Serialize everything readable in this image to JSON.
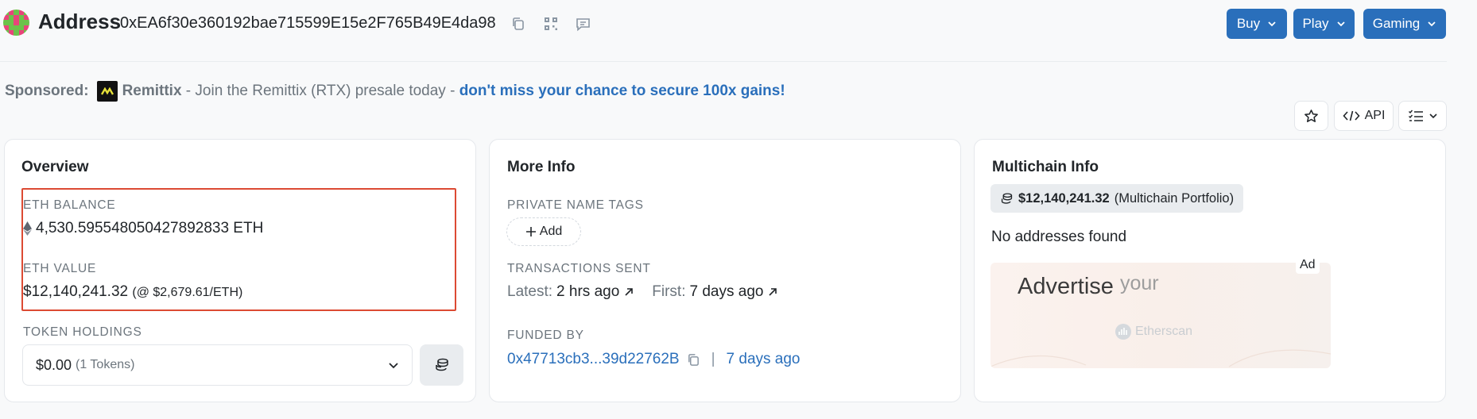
{
  "header": {
    "title": "Address",
    "address": "0xEA6f30e360192bae715599E15e2F765B49E4da98",
    "buttons": [
      {
        "label": "Buy"
      },
      {
        "label": "Play"
      },
      {
        "label": "Gaming"
      }
    ]
  },
  "sponsored": {
    "label": "Sponsored:",
    "brand": "Remittix",
    "text": " - Join the Remittix (RTX) presale today - ",
    "link": "don't miss your chance to secure 100x gains!"
  },
  "toolbar": {
    "api_label": "API"
  },
  "overview": {
    "title": "Overview",
    "eth_balance_label": "ETH BALANCE",
    "eth_balance": "4,530.595548050427892833 ETH",
    "eth_value_label": "ETH VALUE",
    "eth_value": "$12,140,241.32",
    "eth_price": "$2,679.61/ETH",
    "token_holdings_label": "TOKEN HOLDINGS",
    "token_value": "$0.00",
    "token_count": "(1 Tokens)"
  },
  "more_info": {
    "title": "More Info",
    "private_tags_label": "PRIVATE NAME TAGS",
    "add_label": "Add",
    "tx_sent_label": "TRANSACTIONS SENT",
    "latest_label": "Latest:",
    "latest_value": "2 hrs ago",
    "first_label": "First:",
    "first_value": "7 days ago",
    "funded_by_label": "FUNDED BY",
    "funded_address": "0x47713cb3...39d22762B",
    "separator": "|",
    "funded_time": "7 days ago"
  },
  "multichain": {
    "title": "Multichain Info",
    "portfolio_value": "$12,140,241.32",
    "portfolio_suffix": "(Multichain Portfolio)",
    "empty_text": "No addresses found",
    "ad": {
      "headline": "Advertise",
      "headline_tail": "your",
      "brand": "Etherscan",
      "tag": "Ad"
    }
  },
  "colors": {
    "accent": "#2a6fbb",
    "highlight_border": "#dc4a33"
  }
}
